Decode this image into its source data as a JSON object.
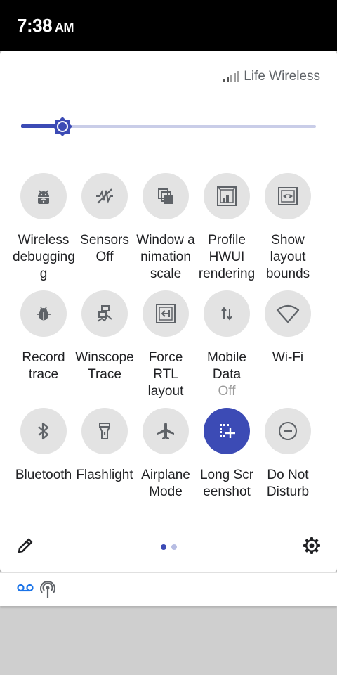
{
  "status_bar": {
    "time": "7:38",
    "ampm": "AM"
  },
  "carrier": {
    "name": "Life Wireless"
  },
  "brightness": {
    "level": 0.14
  },
  "tiles": [
    {
      "label": "Wireless\ndebugging\ng",
      "icon": "android-icon"
    },
    {
      "label": "Sensors\nOff",
      "icon": "sensors-off-icon"
    },
    {
      "label": "Window a\nnimation\nscale",
      "icon": "window-animation-icon"
    },
    {
      "label": "Profile\nHWUI\nrendering",
      "icon": "profile-hwui-icon"
    },
    {
      "label": "Show\nlayout\nbounds",
      "icon": "layout-bounds-icon"
    },
    {
      "label": "Record\ntrace",
      "icon": "bug-icon"
    },
    {
      "label": "Winscope\nTrace",
      "icon": "winscope-icon"
    },
    {
      "label": "Force\nRTL\nlayout",
      "icon": "rtl-icon"
    },
    {
      "label": "Mobile\nData",
      "sub": "Off",
      "icon": "mobile-data-icon"
    },
    {
      "label": "Wi-Fi",
      "icon": "wifi-icon"
    },
    {
      "label": "Bluetooth",
      "icon": "bluetooth-icon"
    },
    {
      "label": "Flashlight",
      "icon": "flashlight-icon"
    },
    {
      "label": "Airplane\nMode",
      "icon": "airplane-icon"
    },
    {
      "label": "Long Scr\neenshot",
      "icon": "long-screenshot-icon",
      "active": true
    },
    {
      "label": "Do Not\nDisturb",
      "icon": "dnd-icon"
    }
  ],
  "footer": {
    "page_count": 2,
    "current_page": 1
  },
  "notification_icons": [
    "voicemail-icon",
    "hotspot-icon"
  ],
  "colors": {
    "accent": "#3c4bb5",
    "tile_bg": "#e3e3e3",
    "icon": "#5f6368"
  }
}
